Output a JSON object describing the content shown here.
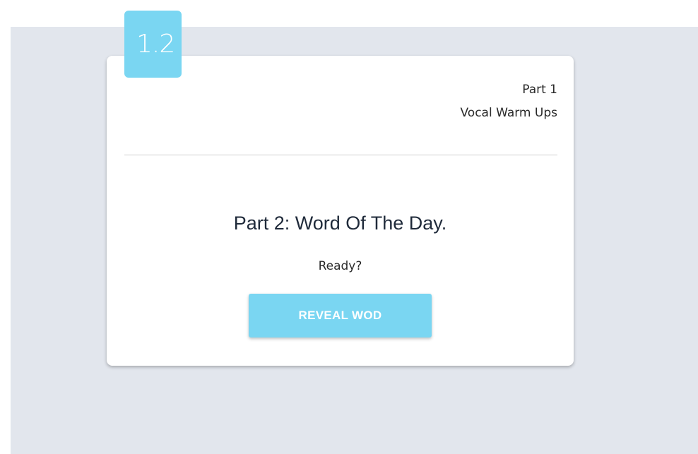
{
  "badge": {
    "step_number": "1.2"
  },
  "header": {
    "part": "Part 1",
    "section": "Vocal Warm Ups"
  },
  "main": {
    "heading": "Part 2: Word Of The Day.",
    "prompt": "Ready?",
    "button_label": "REVEAL WOD"
  },
  "colors": {
    "accent": "#7ad6f2",
    "background": "#e2e6ed",
    "card": "#ffffff",
    "heading_text": "#1f2a3a"
  }
}
